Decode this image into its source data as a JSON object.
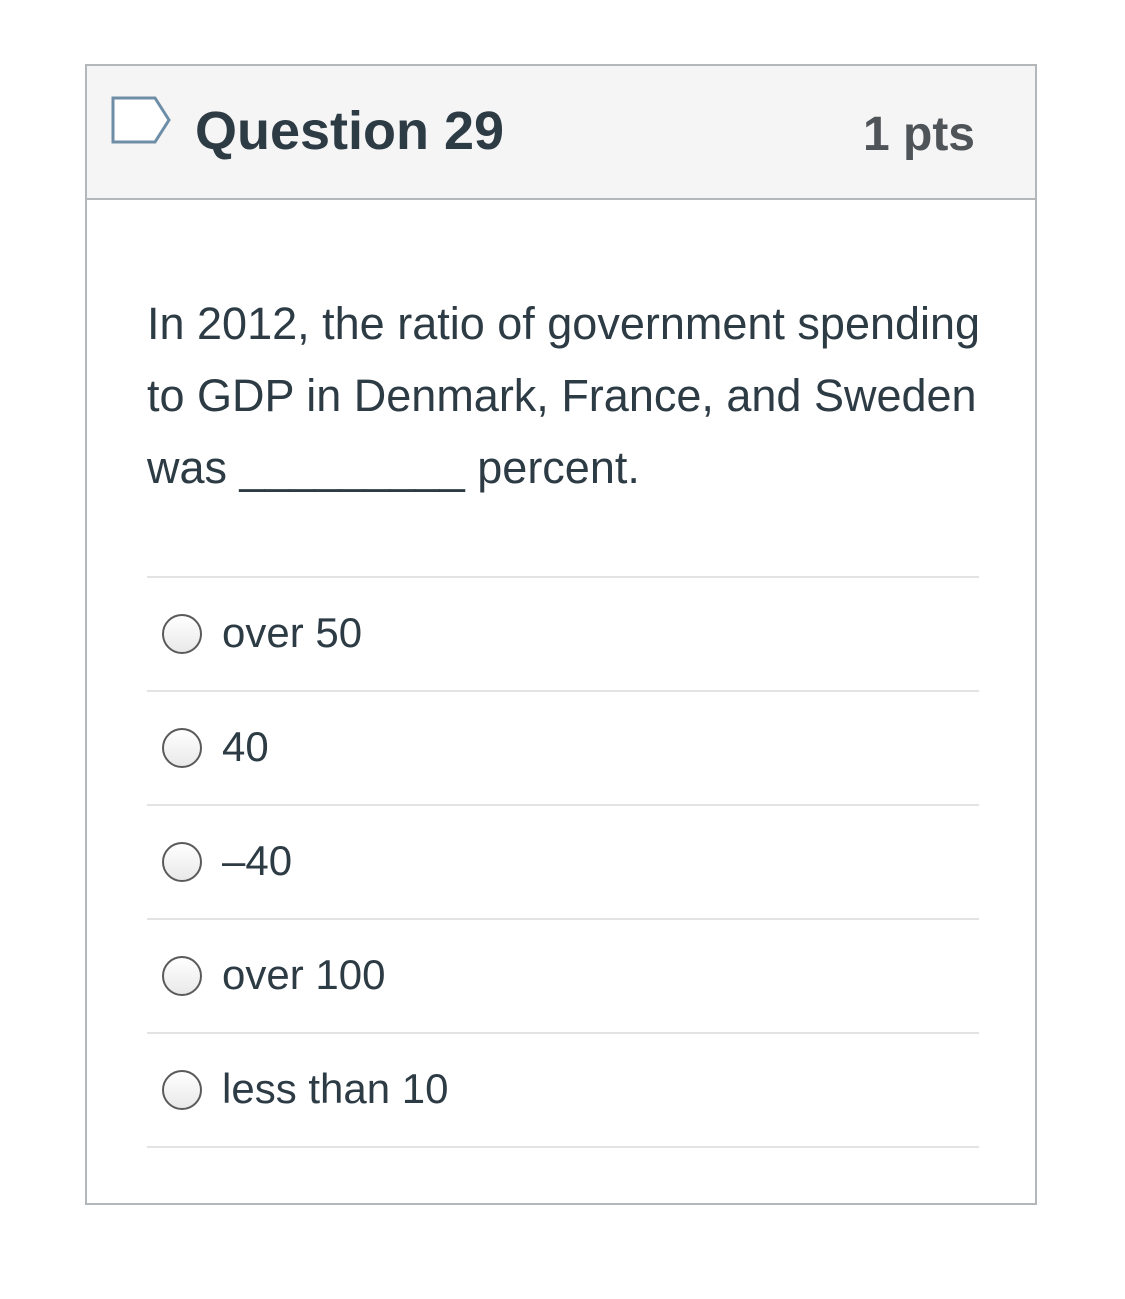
{
  "question": {
    "title": "Question 29",
    "points": "1 pts",
    "text": "In 2012, the ratio of government spending to GDP in Denmark, France, and Sweden was _________ percent.",
    "flag_icon": "flag-bookmark-icon",
    "answers": [
      {
        "label": "over 50"
      },
      {
        "label": "40"
      },
      {
        "label": "–40"
      },
      {
        "label": "over 100"
      },
      {
        "label": "less than 10"
      }
    ]
  },
  "colors": {
    "header_bg": "#f5f5f5",
    "border": "#b4b7ba",
    "text": "#2d3b45",
    "flag": "#6e8ea8"
  }
}
